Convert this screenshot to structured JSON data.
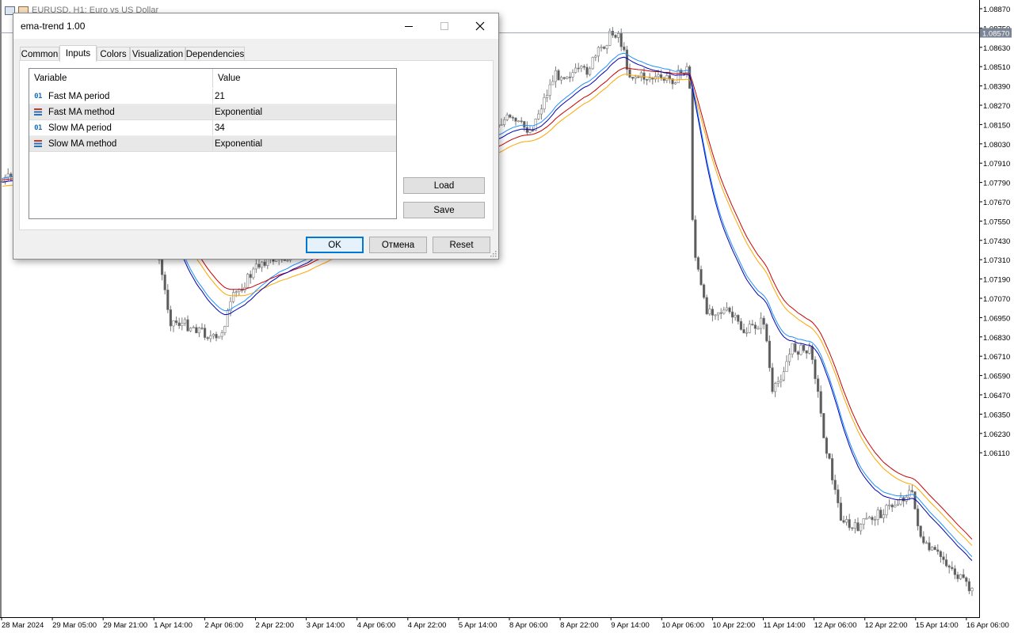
{
  "chart": {
    "window_title": "EURUSD, H1:  Euro vs US Dollar",
    "current_price": "1.08570",
    "price_labels": [
      "1.08870",
      "1.08750",
      "1.08630",
      "1.08510",
      "1.08390",
      "1.08270",
      "1.08150",
      "1.08030",
      "1.07910",
      "1.07790",
      "1.07670",
      "1.07550",
      "1.07430",
      "1.07310",
      "1.07190",
      "1.07070",
      "1.06950",
      "1.06830",
      "1.06710",
      "1.06590",
      "1.06470",
      "1.06350",
      "1.06230",
      "1.06110"
    ],
    "time_labels": [
      "28 Mar 2024",
      "29 Mar 05:00",
      "29 Mar 21:00",
      "1 Apr 14:00",
      "2 Apr 06:00",
      "2 Apr 22:00",
      "3 Apr 14:00",
      "4 Apr 06:00",
      "4 Apr 22:00",
      "5 Apr 14:00",
      "8 Apr 06:00",
      "8 Apr 22:00",
      "9 Apr 14:00",
      "10 Apr 06:00",
      "10 Apr 22:00",
      "11 Apr 14:00",
      "12 Apr 06:00",
      "12 Apr 22:00",
      "15 Apr 14:00",
      "16 Apr 06:00"
    ],
    "colors": {
      "fast_ma": "#0000b4",
      "slow_ma": "#c80000",
      "band_blue": "#1e90ff",
      "band_orange": "#ffa500",
      "candle": "#7a7a7a",
      "price_line": "#7f8a99"
    }
  },
  "dialog": {
    "title": "ema-trend 1.00",
    "tabs": [
      {
        "label": "Common",
        "active": false
      },
      {
        "label": "Inputs",
        "active": true
      },
      {
        "label": "Colors",
        "active": false
      },
      {
        "label": "Visualization",
        "active": false
      },
      {
        "label": "Dependencies",
        "active": false
      }
    ],
    "grid": {
      "col_variable": "Variable",
      "col_value": "Value",
      "rows": [
        {
          "icon": "int-param-icon",
          "icon_text": "01",
          "variable": "Fast MA period",
          "value": "21"
        },
        {
          "icon": "enum-param-icon",
          "icon_text": "",
          "variable": "Fast MA method",
          "value": "Exponential"
        },
        {
          "icon": "int-param-icon",
          "icon_text": "01",
          "variable": "Slow MA period",
          "value": "34"
        },
        {
          "icon": "enum-param-icon",
          "icon_text": "",
          "variable": "Slow MA method",
          "value": "Exponential"
        }
      ]
    },
    "buttons": {
      "load": "Load",
      "save": "Save",
      "ok": "OK",
      "cancel": "Отмена",
      "reset": "Reset"
    }
  }
}
